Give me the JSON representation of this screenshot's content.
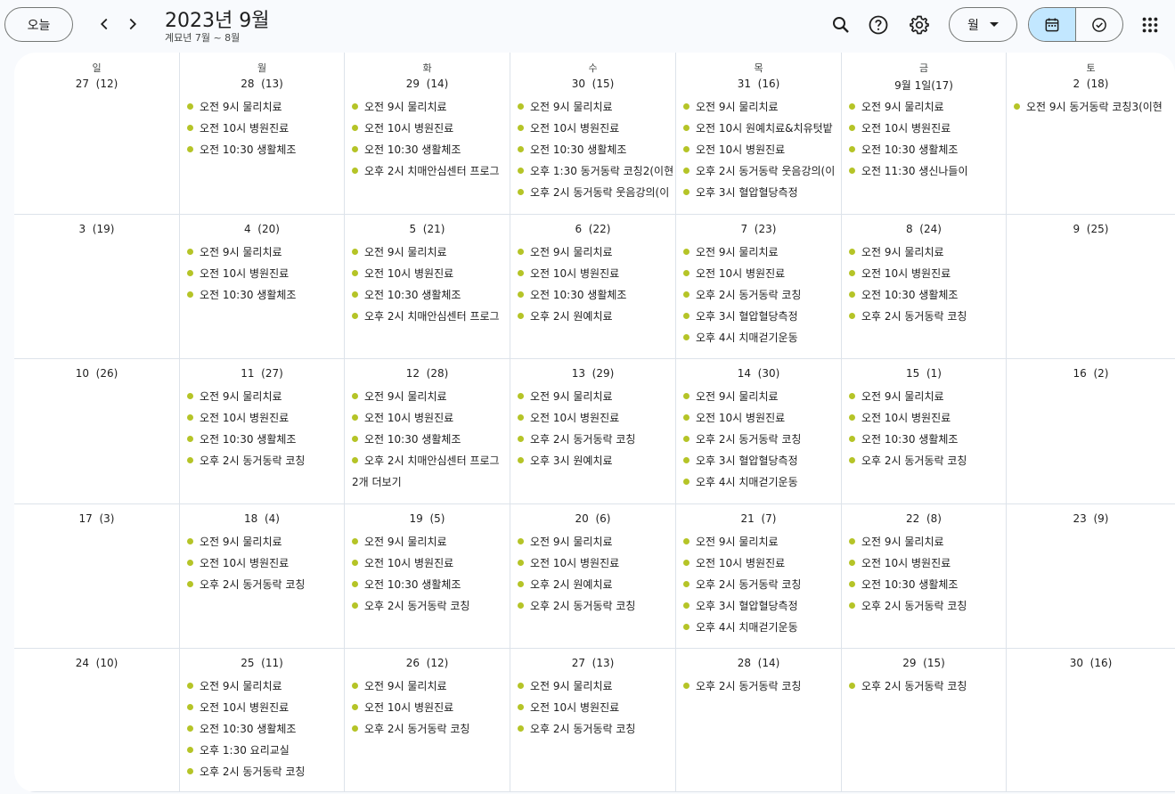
{
  "header": {
    "today_label": "오늘",
    "title": "2023년 9월",
    "subtitle": "계묘년 7월 ~ 8월",
    "view_label": "월"
  },
  "colors": {
    "event_dot": "#b5c427",
    "accent": "#c2e7ff"
  },
  "weekdays": [
    "일",
    "월",
    "화",
    "수",
    "목",
    "금",
    "토"
  ],
  "weeks": [
    [
      {
        "date": "27  (12)",
        "events": []
      },
      {
        "date": "28  (13)",
        "events": [
          "오전 9시 물리치료",
          "오전 10시 병원진료",
          "오전 10:30 생활체조"
        ]
      },
      {
        "date": "29  (14)",
        "events": [
          "오전 9시 물리치료",
          "오전 10시 병원진료",
          "오전 10:30 생활체조",
          "오후 2시 치매안심센터 프로그"
        ]
      },
      {
        "date": "30  (15)",
        "events": [
          "오전 9시 물리치료",
          "오전 10시 병원진료",
          "오전 10:30 생활체조",
          "오후 1:30 동거동락 코칭2(이현",
          "오후 2시 동거동락 웃음강의(이"
        ]
      },
      {
        "date": "31  (16)",
        "events": [
          "오전 9시 물리치료",
          "오전 10시 원예치료&치유텃밭",
          "오전 10시 병원진료",
          "오후 2시 동거동락 웃음강의(이",
          "오후 3시 혈압혈당측정"
        ]
      },
      {
        "date": "9월 1일(17)",
        "events": [
          "오전 9시 물리치료",
          "오전 10시 병원진료",
          "오전 10:30 생활체조",
          "오전 11:30 생신나들이"
        ]
      },
      {
        "date": "2  (18)",
        "events": [
          "오전 9시 동거동락 코칭3(이현"
        ]
      }
    ],
    [
      {
        "date": "3  (19)",
        "events": []
      },
      {
        "date": "4  (20)",
        "events": [
          "오전 9시 물리치료",
          "오전 10시 병원진료",
          "오전 10:30 생활체조"
        ]
      },
      {
        "date": "5  (21)",
        "events": [
          "오전 9시 물리치료",
          "오전 10시 병원진료",
          "오전 10:30 생활체조",
          "오후 2시 치매안심센터 프로그"
        ]
      },
      {
        "date": "6  (22)",
        "events": [
          "오전 9시 물리치료",
          "오전 10시 병원진료",
          "오전 10:30 생활체조",
          "오후 2시 원예치료"
        ]
      },
      {
        "date": "7  (23)",
        "events": [
          "오전 9시 물리치료",
          "오전 10시 병원진료",
          "오후 2시 동거동락 코칭",
          "오후 3시 혈압혈당측정",
          "오후 4시 치매걷기운동"
        ]
      },
      {
        "date": "8  (24)",
        "events": [
          "오전 9시 물리치료",
          "오전 10시 병원진료",
          "오전 10:30 생활체조",
          "오후 2시 동거동락 코칭"
        ]
      },
      {
        "date": "9  (25)",
        "events": []
      }
    ],
    [
      {
        "date": "10  (26)",
        "events": []
      },
      {
        "date": "11  (27)",
        "events": [
          "오전 9시 물리치료",
          "오전 10시 병원진료",
          "오전 10:30 생활체조",
          "오후 2시 동거동락 코칭"
        ]
      },
      {
        "date": "12  (28)",
        "events": [
          "오전 9시 물리치료",
          "오전 10시 병원진료",
          "오전 10:30 생활체조",
          "오후 2시 치매안심센터 프로그"
        ],
        "more": "2개 더보기"
      },
      {
        "date": "13  (29)",
        "events": [
          "오전 9시 물리치료",
          "오전 10시 병원진료",
          "오후 2시 동거동락 코칭",
          "오후 3시 원예치료"
        ]
      },
      {
        "date": "14  (30)",
        "events": [
          "오전 9시 물리치료",
          "오전 10시 병원진료",
          "오후 2시 동거동락 코칭",
          "오후 3시 혈압혈당측정",
          "오후 4시 치매걷기운동"
        ]
      },
      {
        "date": "15  (1)",
        "events": [
          "오전 9시 물리치료",
          "오전 10시 병원진료",
          "오전 10:30 생활체조",
          "오후 2시 동거동락 코칭"
        ]
      },
      {
        "date": "16  (2)",
        "events": []
      }
    ],
    [
      {
        "date": "17  (3)",
        "events": []
      },
      {
        "date": "18  (4)",
        "events": [
          "오전 9시 물리치료",
          "오전 10시 병원진료",
          "오후 2시 동거동락 코칭"
        ]
      },
      {
        "date": "19  (5)",
        "events": [
          "오전 9시 물리치료",
          "오전 10시 병원진료",
          "오전 10:30 생활체조",
          "오후 2시 동거동락 코칭"
        ]
      },
      {
        "date": "20  (6)",
        "events": [
          "오전 9시 물리치료",
          "오전 10시 병원진료",
          "오후 2시 원예치료",
          "오후 2시 동거동락 코칭"
        ]
      },
      {
        "date": "21  (7)",
        "events": [
          "오전 9시 물리치료",
          "오전 10시 병원진료",
          "오후 2시 동거동락 코칭",
          "오후 3시 혈압혈당측정",
          "오후 4시 치매걷기운동"
        ]
      },
      {
        "date": "22  (8)",
        "events": [
          "오전 9시 물리치료",
          "오전 10시 병원진료",
          "오전 10:30 생활체조",
          "오후 2시 동거동락 코칭"
        ]
      },
      {
        "date": "23  (9)",
        "events": []
      }
    ],
    [
      {
        "date": "24  (10)",
        "events": []
      },
      {
        "date": "25  (11)",
        "events": [
          "오전 9시 물리치료",
          "오전 10시 병원진료",
          "오전 10:30 생활체조",
          "오후 1:30 요리교실",
          "오후 2시 동거동락 코칭"
        ]
      },
      {
        "date": "26  (12)",
        "events": [
          "오전 9시 물리치료",
          "오전 10시 병원진료",
          "오후 2시 동거동락 코칭"
        ]
      },
      {
        "date": "27  (13)",
        "events": [
          "오전 9시 물리치료",
          "오전 10시 병원진료",
          "오후 2시 동거동락 코칭"
        ]
      },
      {
        "date": "28  (14)",
        "events": [
          "오후 2시 동거동락 코칭"
        ]
      },
      {
        "date": "29  (15)",
        "events": [
          "오후 2시 동거동락 코칭"
        ]
      },
      {
        "date": "30  (16)",
        "events": []
      }
    ]
  ]
}
